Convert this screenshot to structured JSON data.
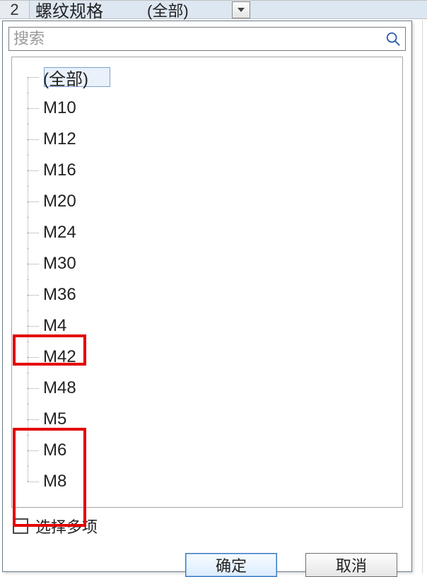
{
  "header": {
    "row_number": "2",
    "field_name": "螺纹规格",
    "field_value": "(全部)"
  },
  "popup": {
    "search_placeholder": "搜索",
    "tree_items": [
      {
        "label": "(全部)",
        "root": true,
        "hovered": true
      },
      {
        "label": "M10"
      },
      {
        "label": "M12"
      },
      {
        "label": "M16"
      },
      {
        "label": "M20"
      },
      {
        "label": "M24"
      },
      {
        "label": "M30"
      },
      {
        "label": "M36"
      },
      {
        "label": "M4"
      },
      {
        "label": "M42"
      },
      {
        "label": "M48"
      },
      {
        "label": "M5"
      },
      {
        "label": "M6"
      },
      {
        "label": "M8"
      }
    ],
    "highlighted_items": [
      "M4",
      "M5",
      "M6",
      "M8"
    ],
    "multi_select_label": "选择多项",
    "ok_label": "确定",
    "cancel_label": "取消"
  }
}
